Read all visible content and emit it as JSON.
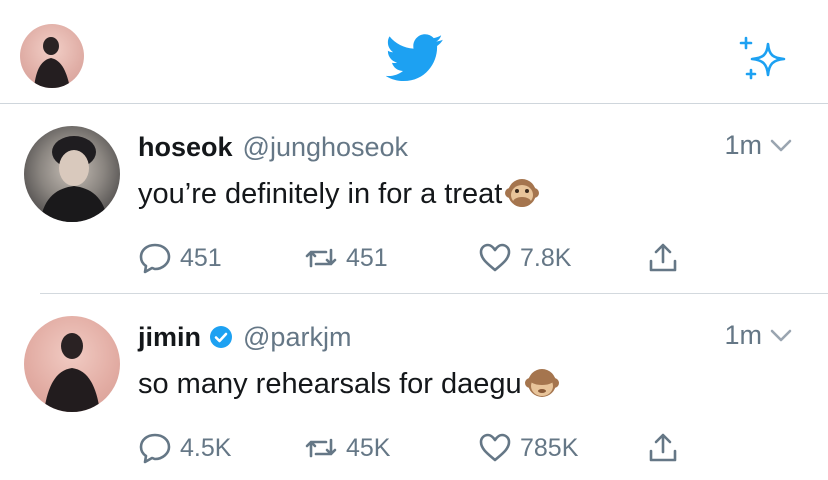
{
  "header": {
    "avatar_icon": "profile-avatar",
    "logo_icon": "twitter-bird-icon",
    "logo_color": "#1da1f2",
    "sparkle_icon": "sparkle-icon"
  },
  "tweets": [
    {
      "name": "hoseok",
      "handle": "@junghoseok",
      "verified": false,
      "time": "1m",
      "text": "you’re definitely in for a treat",
      "emoji": "speak-no-evil-monkey",
      "replies": "451",
      "retweets": "451",
      "likes": "7.8K"
    },
    {
      "name": "jimin",
      "handle": "@parkjm",
      "verified": true,
      "time": "1m",
      "text": "so many rehearsals for daegu",
      "emoji": "see-no-evil-monkey",
      "replies": "4.5K",
      "retweets": "45K",
      "likes": "785K"
    }
  ],
  "colors": {
    "text_primary": "#14171a",
    "text_secondary": "#657786",
    "accent": "#1da1f2",
    "divider": "#d3d9de"
  }
}
